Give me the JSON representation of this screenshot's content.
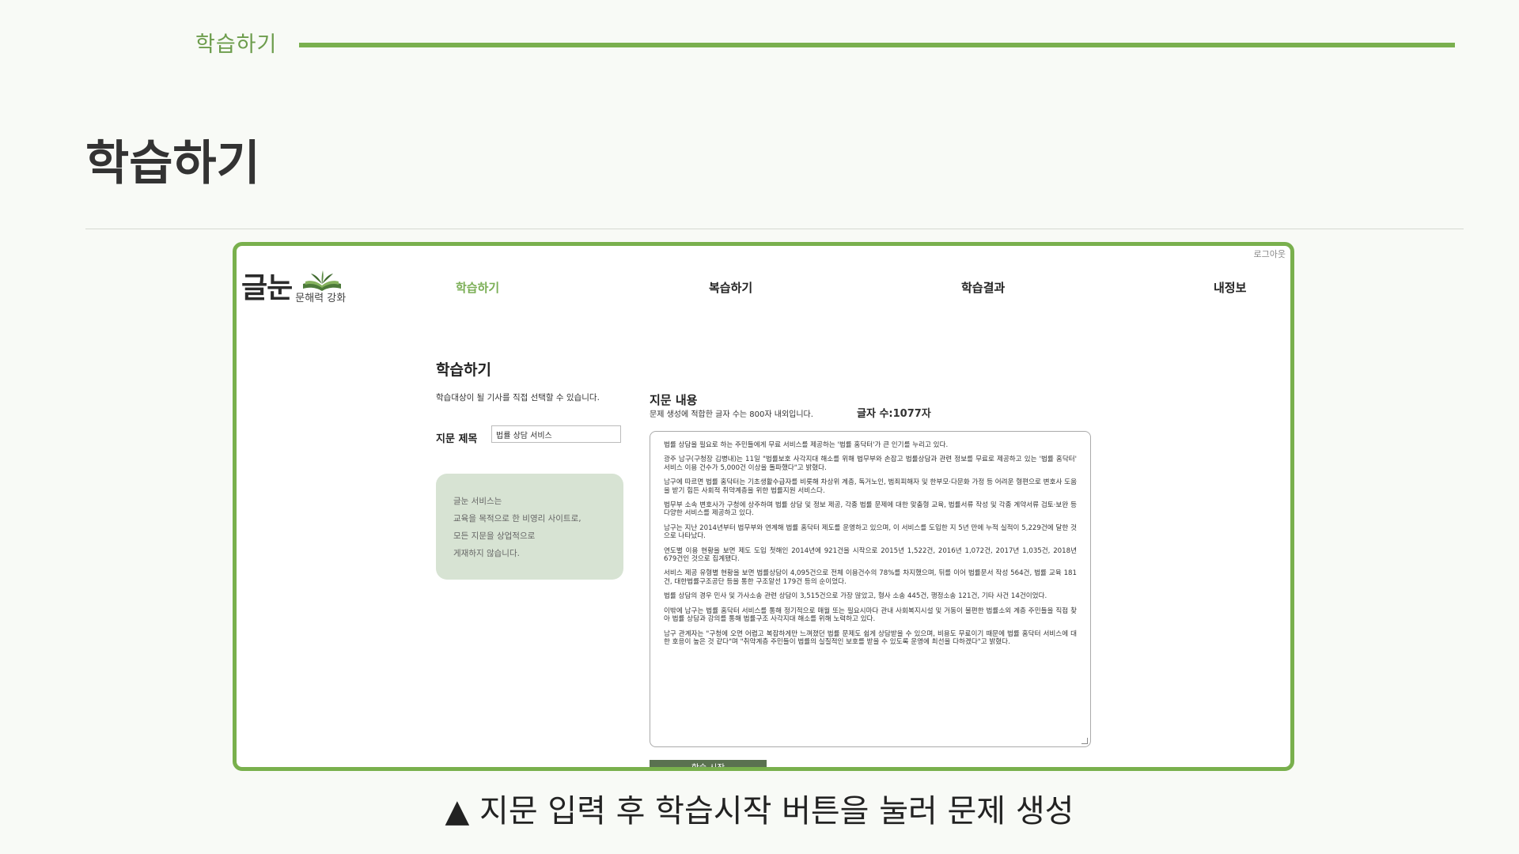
{
  "slide": {
    "tag": "학습하기",
    "title": "학습하기",
    "caption": "▲ 지문 입력 후 학습시작 버튼을 눌러 문제 생성"
  },
  "app": {
    "logout": "로그아웃",
    "logo": {
      "main": "글눈",
      "sub": "문해력 강화",
      "icon": "open-book-icon"
    },
    "nav": [
      "학습하기",
      "복습하기",
      "학습결과",
      "내정보"
    ],
    "active_nav": "학습하기",
    "page_title": "학습하기",
    "page_desc": "학습대상이 될 기사를 직접 선택할 수 있습니다.",
    "title_field": {
      "label": "지문 제목",
      "value": "법률 상담 서비스"
    },
    "notice": [
      "글눈 서비스는",
      "교육을 목적으로 한 비영리 사이트로,",
      "모든 지문을 상업적으로",
      "게재하지 않습니다."
    ],
    "passage": {
      "label": "지문 내용",
      "hint": "문제 생성에 적합한 글자 수는 800자 내외입니다.",
      "count_label": "글자 수:",
      "count_value": "1077자",
      "paragraphs": [
        "법률 상담을 필요로 하는 주민들에게 무료 서비스를 제공하는 '법률 홈닥터'가 큰 인기를 누리고 있다.",
        "광주 남구(구청장 김병내)는 11일 \"법률보호 사각지대 해소를 위해 법무부와 손잡고 법률상담과 관련 정보를 무료로 제공하고 있는 '법률 홈닥터' 서비스 이용 건수가 5,000건 이상을 돌파했다\"고 밝혔다.",
        "남구에 따르면 법률 홈닥터는 기초생활수급자를 비롯해 차상위 계층, 독거노인, 범죄피해자 및 한부모·다문화 가정 등 어려운 형편으로 변호사 도움을 받기 힘든 사회적 취약계층을 위한 법률지원 서비스다.",
        "법무부 소속 변호사가 구청에 상주하며 법률 상담 및 정보 제공, 각종 법률 문제에 대한 맞춤형 교육, 법률서류 작성 및 각종 계약서류 검토·보완 등 다양한 서비스를 제공하고 있다.",
        "남구는 지난 2014년부터 법무부와 연계해 법률 홈닥터 제도를 운영하고 있으며, 이 서비스를 도입한 지 5년 만에 누적 실적이 5,229건에 달한 것으로 나타났다.",
        "연도별 이용 현황을 보면 제도 도입 첫해인 2014년에 921건을 시작으로 2015년 1,522건, 2016년 1,072건, 2017년 1,035건, 2018년 679건인 것으로 집계됐다.",
        "서비스 제공 유형별 현황을 보면 법률상담이 4,095건으로 전체 이용건수의 78%를 차지했으며, 뒤를 이어 법률문서 작성 564건, 법률 교육 181건, 대한법률구조공단 등을 통한 구조알선 179건 등의 순이었다.",
        "법률 상담의 경우 민사 및 가사소송 관련 상담이 3,515건으로 가장 많았고, 형사 소송 445건, 행정소송 121건, 기타 사건 14건이었다.",
        "이밖에 남구는 법률 홈닥터 서비스를 통해 정기적으로 매월 또는 필요시마다 관내 사회복지시설 및 거동이 불편한 법률소외 계층 주민들을 직접 찾아 법률 상담과 강의를 통해 법률구조 사각지대 해소를 위해 노력하고 있다.",
        "남구 관계자는 \"구청에 오면 어렵고 복잡하게만 느껴졌던 법률 문제도 쉽게 상담받을 수 있으며, 비용도 무료이기 때문에 법률 홈닥터 서비스에 대한 호응이 높은 것 같다\"며 \"취약계층 주민들이 법률의 실질적인 보호를 받을 수 있도록 운영에 최선을 다하겠다\"고 밝혔다."
      ]
    },
    "start_button": "학습 시작"
  },
  "colors": {
    "accent": "#7ab04f",
    "nav_active": "#7aae55",
    "notice_bg": "#d7e3d3",
    "button_bg": "#5a7150"
  }
}
